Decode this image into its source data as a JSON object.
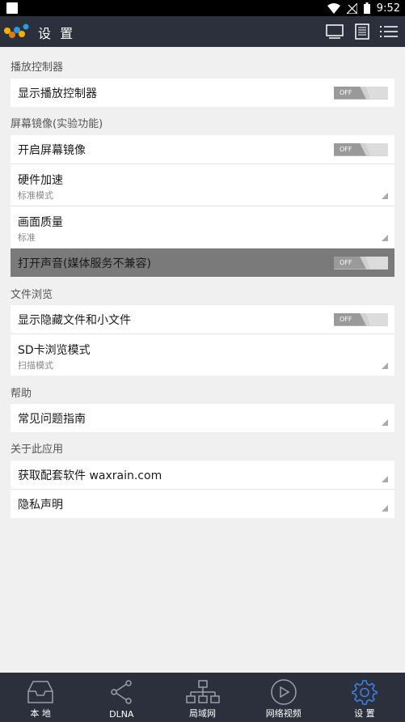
{
  "status_bar": {
    "time": "9:52"
  },
  "app_bar": {
    "title": "设 置",
    "actions": [
      "monitor-icon",
      "document-list-icon",
      "menu-list-icon"
    ]
  },
  "sections": [
    {
      "header": "播放控制器",
      "items": [
        {
          "label": "显示播放控制器",
          "toggle": "OFF"
        }
      ]
    },
    {
      "header": "屏幕镜像(实验功能)",
      "items": [
        {
          "label": "开启屏幕镜像",
          "toggle": "OFF"
        },
        {
          "label": "硬件加速",
          "value": "标准模式"
        },
        {
          "label": "画面质量",
          "value": "标准"
        },
        {
          "label": "打开声音(媒体服务不兼容)",
          "toggle": "OFF",
          "state": "disabled"
        }
      ]
    },
    {
      "header": "文件浏览",
      "items": [
        {
          "label": "显示隐藏文件和小文件",
          "toggle": "OFF"
        },
        {
          "label": "SD卡浏览模式",
          "value": "扫描模式"
        }
      ]
    },
    {
      "header": "帮助",
      "items": [
        {
          "label": "常见问题指南"
        }
      ]
    },
    {
      "header": "关于此应用",
      "items": [
        {
          "label": "获取配套软件 waxrain.com"
        },
        {
          "label": "隐私声明"
        }
      ]
    }
  ],
  "bottom_nav": [
    {
      "label": "本 地",
      "icon": "inbox-tray-icon"
    },
    {
      "label": "DLNA",
      "icon": "share-icon"
    },
    {
      "label": "局域网",
      "icon": "network-icon"
    },
    {
      "label": "网络视频",
      "icon": "play-circle-icon"
    },
    {
      "label": "设 置",
      "icon": "gear-icon",
      "active": true
    }
  ],
  "colors": {
    "app_bar": "#2b303c",
    "background": "#f0f0f0",
    "active_tab": "#3d7ee6",
    "disabled_row": "#7a7a7a"
  }
}
